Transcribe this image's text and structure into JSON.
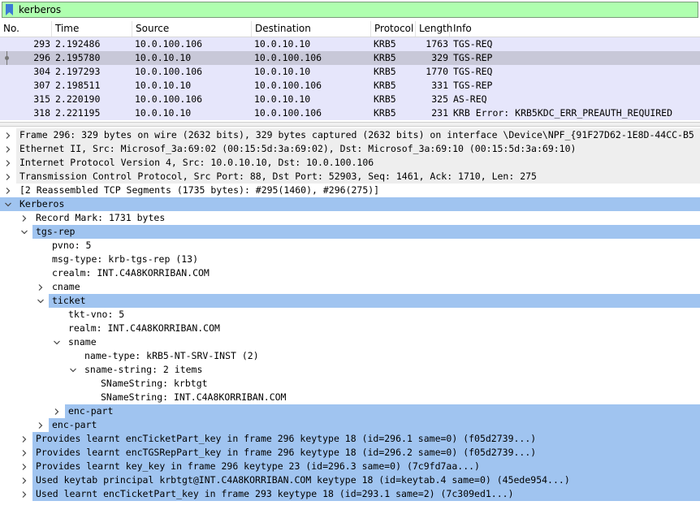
{
  "filter": {
    "value": "kerberos",
    "bg": "#afffaf"
  },
  "packet_list": {
    "columns": [
      "No.",
      "Time",
      "Source",
      "Destination",
      "Protocol",
      "Length",
      "Info"
    ],
    "rows": [
      {
        "no": "293",
        "time": "2.192486",
        "src": "10.0.100.106",
        "dst": "10.0.10.10",
        "proto": "KRB5",
        "len": "1763",
        "info": "TGS-REQ"
      },
      {
        "no": "296",
        "time": "2.195780",
        "src": "10.0.10.10",
        "dst": "10.0.100.106",
        "proto": "KRB5",
        "len": "329",
        "info": "TGS-REP"
      },
      {
        "no": "304",
        "time": "2.197293",
        "src": "10.0.100.106",
        "dst": "10.0.10.10",
        "proto": "KRB5",
        "len": "1770",
        "info": "TGS-REQ"
      },
      {
        "no": "307",
        "time": "2.198511",
        "src": "10.0.10.10",
        "dst": "10.0.100.106",
        "proto": "KRB5",
        "len": "331",
        "info": "TGS-REP"
      },
      {
        "no": "315",
        "time": "2.220190",
        "src": "10.0.100.106",
        "dst": "10.0.10.10",
        "proto": "KRB5",
        "len": "325",
        "info": "AS-REQ"
      },
      {
        "no": "318",
        "time": "2.221195",
        "src": "10.0.10.10",
        "dst": "10.0.100.106",
        "proto": "KRB5",
        "len": "231",
        "info": "KRB Error: KRB5KDC_ERR_PREAUTH_REQUIRED"
      }
    ],
    "row_color": "#e6e6fb",
    "selected_color": "#c8c8d8"
  },
  "details": {
    "highlight_color": "#a0c4f0",
    "rows": [
      {
        "text": "Frame 296: 329 bytes on wire (2632 bits), 329 bytes captured (2632 bits) on interface \\Device\\NPF_{91F27D62-1E8D-44CC-B5",
        "expander": "right",
        "style": "grey"
      },
      {
        "text": "Ethernet II, Src: Microsof_3a:69:02 (00:15:5d:3a:69:02), Dst: Microsof_3a:69:10 (00:15:5d:3a:69:10)",
        "expander": "right",
        "style": "grey"
      },
      {
        "text": "Internet Protocol Version 4, Src: 10.0.10.10, Dst: 10.0.100.106",
        "expander": "right",
        "style": "grey"
      },
      {
        "text": "Transmission Control Protocol, Src Port: 88, Dst Port: 52903, Seq: 1461, Ack: 1710, Len: 275",
        "expander": "right",
        "style": "grey"
      },
      {
        "text": "[2 Reassembled TCP Segments (1735 bytes): #295(1460), #296(275)]",
        "expander": "right",
        "style": "none"
      },
      {
        "text": "Kerberos",
        "expander": "down",
        "style": "full"
      },
      {
        "text": "Record Mark: 1731 bytes",
        "expander": "right",
        "style": "none"
      },
      {
        "text": "tgs-rep",
        "expander": "down",
        "style": "full"
      },
      {
        "text": "pvno: 5",
        "expander": "",
        "style": "none"
      },
      {
        "text": "msg-type: krb-tgs-rep (13)",
        "expander": "",
        "style": "none"
      },
      {
        "text": "crealm: INT.C4A8KORRIBAN.COM",
        "expander": "",
        "style": "none"
      },
      {
        "text": "cname",
        "expander": "right",
        "style": "none"
      },
      {
        "text": "ticket",
        "expander": "down",
        "style": "full"
      },
      {
        "text": "tkt-vno: 5",
        "expander": "",
        "style": "none"
      },
      {
        "text": "realm: INT.C4A8KORRIBAN.COM",
        "expander": "",
        "style": "none"
      },
      {
        "text": "sname",
        "expander": "down",
        "style": "none"
      },
      {
        "text": "name-type: kRB5-NT-SRV-INST (2)",
        "expander": "",
        "style": "none"
      },
      {
        "text": "sname-string: 2 items",
        "expander": "down",
        "style": "none"
      },
      {
        "text": "SNameString: krbtgt",
        "expander": "",
        "style": "none"
      },
      {
        "text": "SNameString: INT.C4A8KORRIBAN.COM",
        "expander": "",
        "style": "none"
      },
      {
        "text": "enc-part",
        "expander": "right",
        "style": "block"
      },
      {
        "text": "enc-part",
        "expander": "right",
        "style": "block"
      },
      {
        "text": "Provides learnt encTicketPart_key in frame 296 keytype 18 (id=296.1 same=0) (f05d2739...)",
        "expander": "right",
        "style": "block"
      },
      {
        "text": "Provides learnt encTGSRepPart_key in frame 296 keytype 18 (id=296.2 same=0) (f05d2739...)",
        "expander": "right",
        "style": "block"
      },
      {
        "text": "Provides learnt key_key in frame 296 keytype 23 (id=296.3 same=0) (7c9fd7aa...)",
        "expander": "right",
        "style": "block"
      },
      {
        "text": "Used keytab principal krbtgt@INT.C4A8KORRIBAN.COM keytype 18 (id=keytab.4 same=0) (45ede954...)",
        "expander": "right",
        "style": "block"
      },
      {
        "text": "Used learnt encTicketPart_key in frame 293 keytype 18 (id=293.1 same=2) (7c309ed1...)",
        "expander": "right",
        "style": "block"
      }
    ]
  }
}
